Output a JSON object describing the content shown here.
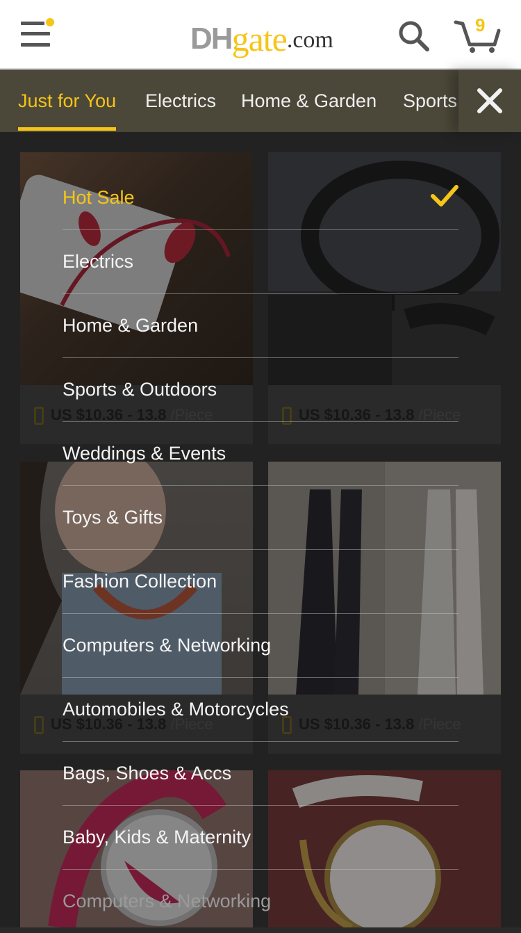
{
  "brand": {
    "logo_dh": "DH",
    "logo_gate": "gate",
    "logo_com": ".com",
    "accent_color": "#f5c518",
    "gray_color": "#9a9a9a"
  },
  "header": {
    "menu_icon": "hamburger-menu-icon",
    "search_icon": "search-icon",
    "cart_icon": "cart-icon",
    "cart_count": "9",
    "notification_dot": true
  },
  "tabs": [
    {
      "label": "Just for You",
      "active": true
    },
    {
      "label": "Electrics",
      "active": false
    },
    {
      "label": "Home & Garden",
      "active": false
    },
    {
      "label": "Sports",
      "active": false
    }
  ],
  "close_icon": "close-icon",
  "products": [
    {
      "price": "US $10.36 - 13.8",
      "unit": "/Piece",
      "image": "earphones-photo"
    },
    {
      "price": "US $10.36 - 13.8",
      "unit": "/Piece",
      "image": "steering-wheel-cover-photo"
    },
    {
      "price": "US $10.36 - 13.8",
      "unit": "/Piece",
      "image": "necklace-model-photo"
    },
    {
      "price": "US $10.36 - 13.8",
      "unit": "/Piece",
      "image": "lace-leggings-photo"
    },
    {
      "price": "",
      "unit": "",
      "image": "red-watch-photo"
    },
    {
      "price": "",
      "unit": "",
      "image": "white-bracelet-watch-photo"
    }
  ],
  "menu": {
    "selected_icon": "checkmark-icon",
    "items": [
      {
        "label": "Hot Sale",
        "selected": true
      },
      {
        "label": "Electrics",
        "selected": false
      },
      {
        "label": "Home & Garden",
        "selected": false
      },
      {
        "label": "Sports & Outdoors",
        "selected": false
      },
      {
        "label": "Weddings & Events",
        "selected": false
      },
      {
        "label": "Toys & Gifts",
        "selected": false
      },
      {
        "label": "Fashion Collection",
        "selected": false
      },
      {
        "label": "Computers & Networking",
        "selected": false
      },
      {
        "label": "Automobiles & Motorcycles",
        "selected": false
      },
      {
        "label": "Bags, Shoes & Accs",
        "selected": false
      },
      {
        "label": "Baby, Kids & Maternity",
        "selected": false
      },
      {
        "label": "Computers & Networking",
        "selected": false
      }
    ]
  }
}
